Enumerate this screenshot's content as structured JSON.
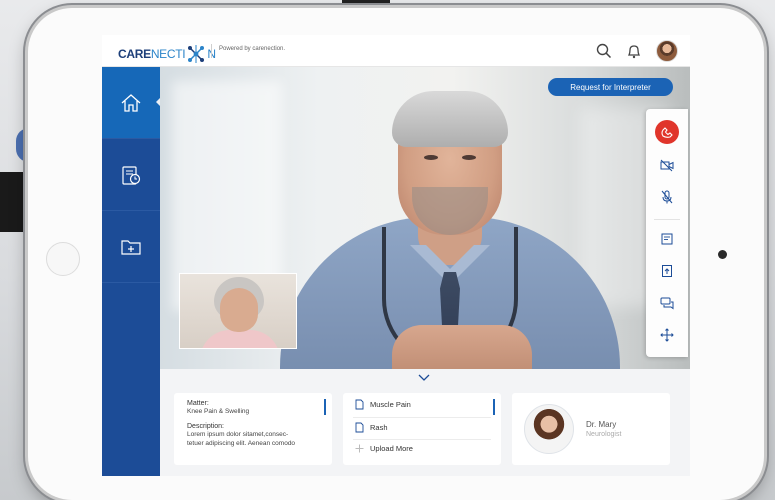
{
  "app": {
    "logo_prefix": "CARE",
    "logo_middle": "NECTI",
    "logo_suffix": "N",
    "powered_by": "Powered by carenection."
  },
  "header": {
    "icons": [
      "search-icon",
      "bell-icon",
      "user-avatar"
    ]
  },
  "sidebar": {
    "items": [
      {
        "icon": "home-icon",
        "active": true
      },
      {
        "icon": "history-icon",
        "active": false
      },
      {
        "icon": "folder-add-icon",
        "active": false
      }
    ]
  },
  "call": {
    "interpreter_button": "Request for Interpreter",
    "controls": [
      "end-call-icon",
      "video-off-icon",
      "mic-off-icon",
      "notes-icon",
      "upload-icon",
      "chat-icon",
      "expand-icon"
    ]
  },
  "matter": {
    "matter_label": "Matter:",
    "matter_value": "Knee Pain & Swelling",
    "description_label": "Description:",
    "description_line1": "Lorem ipsum dolor sitamet,consec-",
    "description_line2": "tetuer adipiscing elit. Aenean comodo"
  },
  "documents": {
    "items": [
      "Muscle Pain",
      "Rash"
    ],
    "upload_label": "Upload More"
  },
  "doctor": {
    "name": "Dr. Mary",
    "role": "Neurologist"
  },
  "colors": {
    "brand_blue": "#1c4c97",
    "active_blue": "#1668b8",
    "button_blue": "#1b63b5",
    "end_call_red": "#e0352b"
  }
}
